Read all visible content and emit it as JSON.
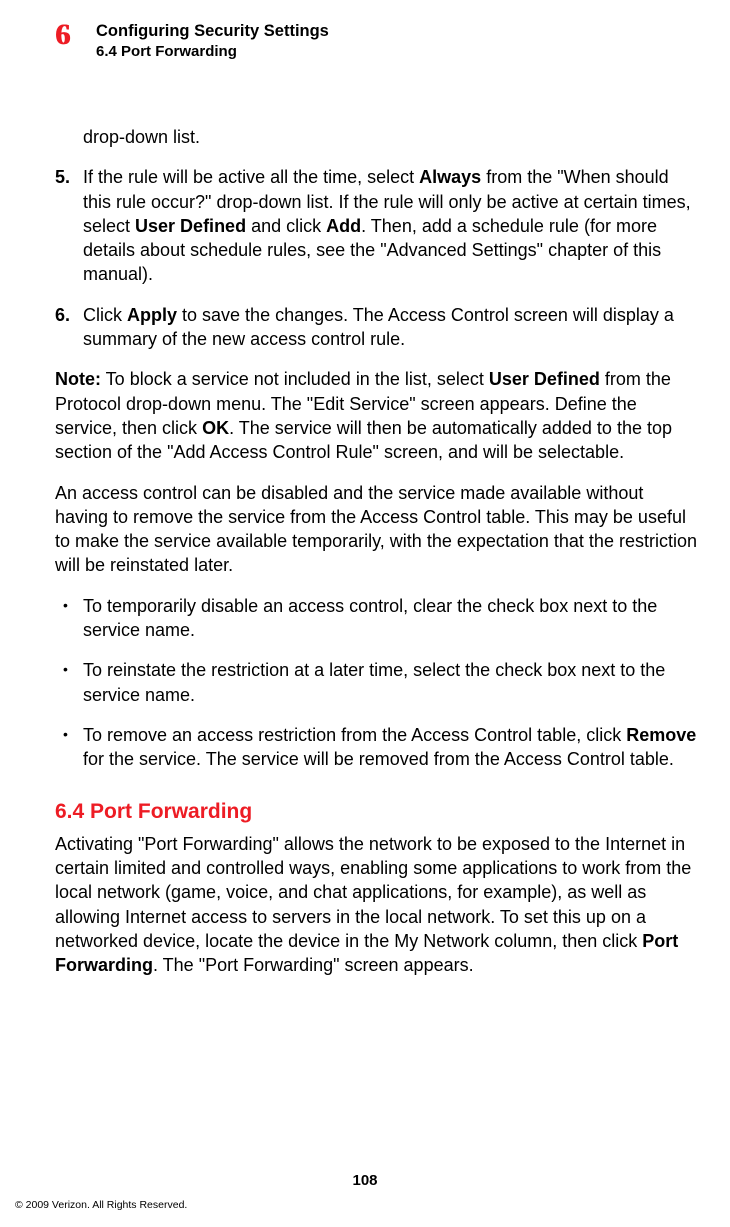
{
  "header": {
    "chapter_number": "6",
    "chapter_title": "Configuring Security Settings",
    "section_label": "6.4  Port Forwarding"
  },
  "frag": {
    "text": "drop-down list."
  },
  "steps": [
    {
      "num": "5.",
      "pre": "If the rule will be active all the time, select ",
      "b1": "Always",
      "mid1": " from the \"When should this rule occur?\" drop-down list. If the rule will only be active at certain times, select ",
      "b2": "User Defined",
      "mid2": " and click ",
      "b3": "Add",
      "tail": ". Then, add a schedule rule (for more details about schedule rules, see the \"Advanced Settings\" chapter of this manual)."
    },
    {
      "num": "6.",
      "pre": "Click ",
      "b1": "Apply",
      "mid1": " to save the changes. The Access Control screen will display a summary of the new access control rule.",
      "b2": "",
      "mid2": "",
      "b3": "",
      "tail": ""
    }
  ],
  "note": {
    "label": "Note:",
    "pre": " To block a service not included in the list, select ",
    "b1": "User Defined",
    "mid1": " from the Protocol drop-down menu. The \"Edit Service\" screen appears. Define the service, then click ",
    "b2": "OK",
    "tail": ". The service will then be automatically added to the top section of the \"Add Access Control Rule\" screen, and will be selectable."
  },
  "para_disable": "An access control can be disabled and the service made available without having to remove the service from the Access Control table. This may be useful to make the service available temporarily, with the expectation that the restriction will be reinstated later.",
  "bullets": [
    {
      "pre": "To temporarily disable an access control, clear the check box next to the service name.",
      "b1": "",
      "tail": ""
    },
    {
      "pre": "To reinstate the restriction at a later time, select the check box next to the service name.",
      "b1": "",
      "tail": ""
    },
    {
      "pre": "To remove an access restriction from the Access Control table, click ",
      "b1": "Remove",
      "tail": " for the service. The service will be removed from the Access Control table."
    }
  ],
  "section": {
    "heading": "6.4  Port Forwarding",
    "pre": "Activating \"Port Forwarding\" allows the network to be exposed to the Internet in certain limited and controlled ways, enabling some applications to work from the local network (game, voice, and chat applications, for example), as well as allowing Internet access to servers in the local network. To set this up on a networked device, locate the device in the My Network column, then click ",
    "b1": "Port Forwarding",
    "tail": ". The \"Port Forwarding\" screen appears."
  },
  "page_number": "108",
  "copyright": "© 2009 Verizon. All Rights Reserved."
}
